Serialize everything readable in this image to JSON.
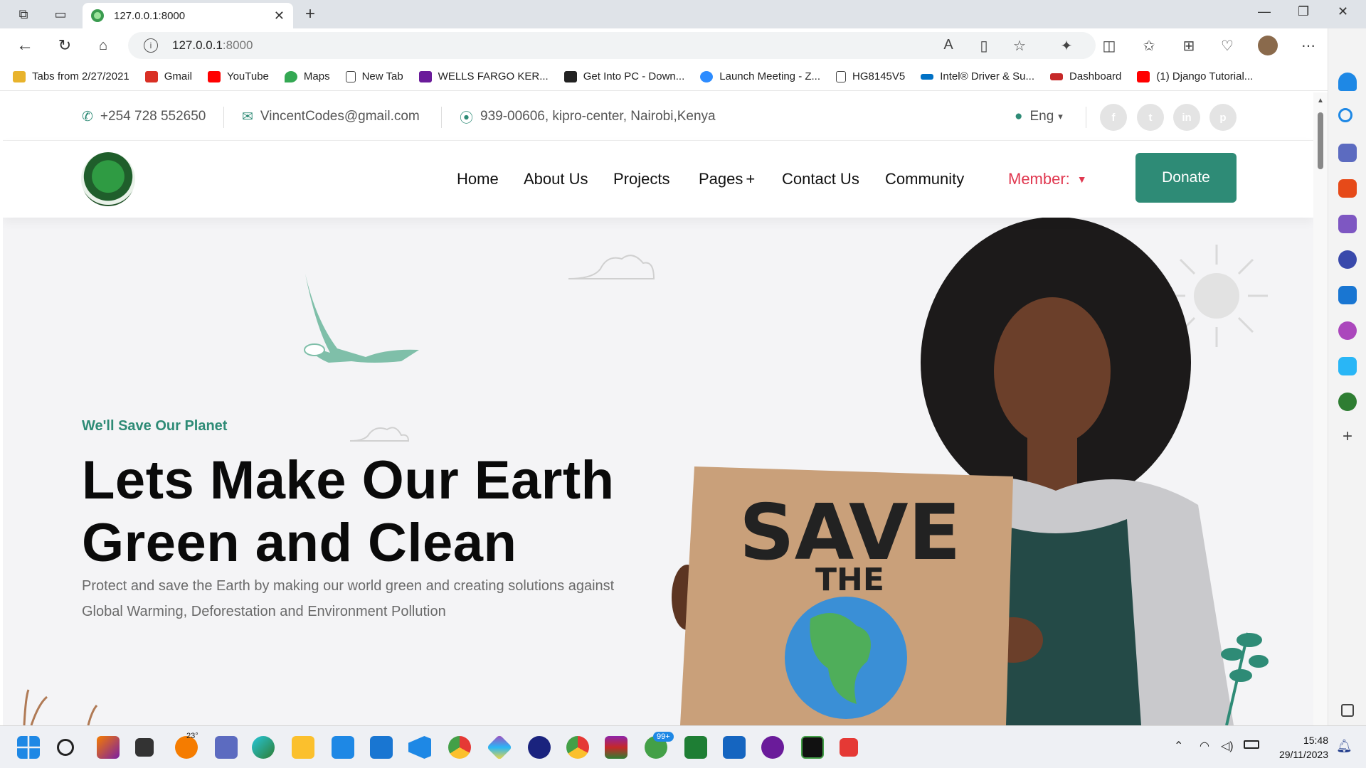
{
  "browser": {
    "tab_title": "127.0.0.1:8000",
    "url_host": "127.0.0.1",
    "url_port": ":8000",
    "bookmarks": [
      {
        "label": "Tabs from 2/27/2021",
        "color": "#e8b32c"
      },
      {
        "label": "Gmail",
        "color": "#d93025"
      },
      {
        "label": "YouTube",
        "color": "#ff0000"
      },
      {
        "label": "Maps",
        "color": "#34a853"
      },
      {
        "label": "New Tab",
        "color": "#ffffff"
      },
      {
        "label": "WELLS FARGO KER...",
        "color": "#6a1b9a"
      },
      {
        "label": "Get Into PC - Down...",
        "color": "#222222"
      },
      {
        "label": "Launch Meeting - Z...",
        "color": "#2d8cff"
      },
      {
        "label": "HG8145V5",
        "color": "#ffffff"
      },
      {
        "label": "Intel® Driver & Su...",
        "color": "#0071c5"
      },
      {
        "label": "Dashboard",
        "color": "#c62828"
      },
      {
        "label": "(1) Django Tutorial...",
        "color": "#ff0000"
      }
    ]
  },
  "topbar": {
    "phone": "+254 728 552650",
    "email": "VincentCodes@gmail.com",
    "address": "939-00606, kipro-center, Nairobi,Kenya",
    "language": "Eng",
    "socials": [
      "f",
      "t",
      "in",
      "p"
    ]
  },
  "nav": {
    "links": [
      "Home",
      "About Us",
      "Projects",
      "Pages",
      "Contact Us",
      "Community"
    ],
    "pages_suffix": "+",
    "member": "Member:",
    "donate": "Donate"
  },
  "hero": {
    "subtitle": "We'll Save Our Planet",
    "title_line1": "Lets Make Our Earth",
    "title_line2": "Green and Clean",
    "description": "Protect and save the Earth by making our world green and creating solutions against Global Warming, Deforestation and Environment Pollution",
    "sign_line1": "SAVE",
    "sign_line2": "THE"
  },
  "taskbar": {
    "weather": "23°",
    "whatsapp_badge": "99+",
    "time": "15:48",
    "date": "29/11/2023"
  },
  "colors": {
    "accent_green": "#2e8b76",
    "member_red": "#e0374f"
  }
}
